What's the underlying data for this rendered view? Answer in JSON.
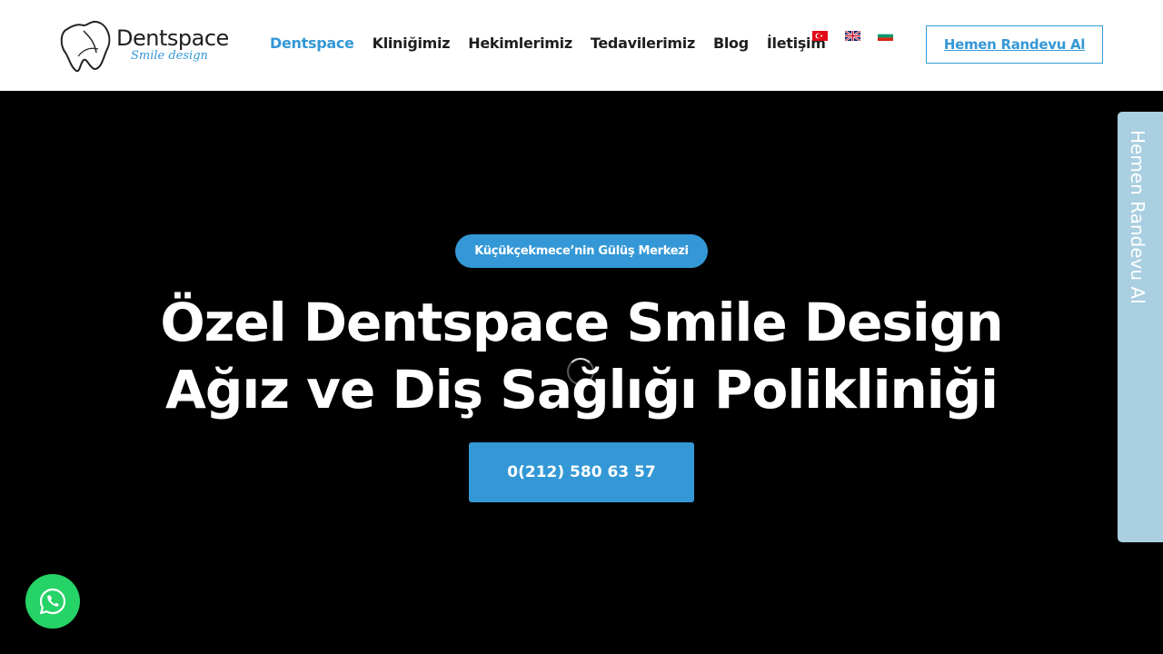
{
  "brand": {
    "name": "Dentspace",
    "tagline": "Smile design"
  },
  "nav": {
    "items": [
      {
        "label": "Dentspace",
        "active": true
      },
      {
        "label": "Kliniğimiz",
        "active": false
      },
      {
        "label": "Hekimlerimiz",
        "active": false
      },
      {
        "label": "Tedavilerimiz",
        "active": false
      },
      {
        "label": "Blog",
        "active": false
      },
      {
        "label": "İletişim",
        "active": false
      }
    ],
    "languages": [
      "tr-flag-icon",
      "gb-flag-icon",
      "bg-flag-icon"
    ],
    "cta_label": "Hemen Randevu Al"
  },
  "hero": {
    "badge": "Küçükçekmece’nin Gülüş Merkezi",
    "title_line1": "Özel Dentspace Smile Design",
    "title_line2": "Ağız ve Diş Sağlığı Polikliniği",
    "phone": "0(212) 580 63 57"
  },
  "side_tab": {
    "label": "Hemen Randevu Al"
  },
  "colors": {
    "accent": "#3498d6",
    "side_tab": "#a9cfe0",
    "whatsapp": "#25d366"
  }
}
